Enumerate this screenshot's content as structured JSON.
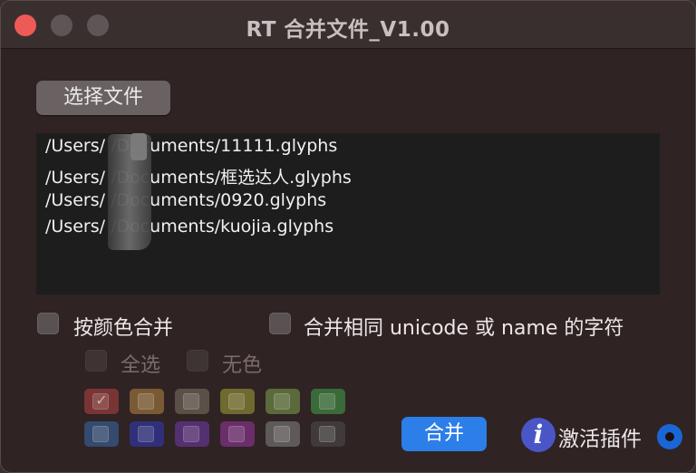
{
  "window": {
    "title": "RT 合并文件_V1.00"
  },
  "toolbar": {
    "choose_file_label": "选择文件"
  },
  "files": [
    "/Users/   /Documents/11111.glyphs",
    "/Users/   /Documents/框选达人.glyphs",
    "/Users/   /Documents/0920.glyphs",
    "/Users/   /Documents/kuojia.glyphs"
  ],
  "options": {
    "merge_by_color": {
      "label": "按颜色合并",
      "checked": false
    },
    "merge_same_unicode": {
      "label": "合并相同 unicode 或 name 的字符",
      "checked": false
    },
    "select_all": {
      "label": "全选",
      "checked": false,
      "enabled": false
    },
    "no_color": {
      "label": "无色",
      "checked": false,
      "enabled": false
    }
  },
  "color_swatches": [
    {
      "name": "red",
      "color": "#7a3434",
      "checked": true
    },
    {
      "name": "orange",
      "color": "#7a5a34",
      "checked": false
    },
    {
      "name": "brown",
      "color": "#5a5048",
      "checked": false
    },
    {
      "name": "yellow",
      "color": "#6e6a30",
      "checked": false
    },
    {
      "name": "light-green",
      "color": "#5a6a3a",
      "checked": false
    },
    {
      "name": "dark-green",
      "color": "#3a6a3a",
      "checked": false
    },
    {
      "name": "light-blue",
      "color": "#344a6e",
      "checked": false
    },
    {
      "name": "dark-blue",
      "color": "#30307a",
      "checked": false
    },
    {
      "name": "purple",
      "color": "#553070",
      "checked": false
    },
    {
      "name": "magenta",
      "color": "#6a2e6a",
      "checked": false
    },
    {
      "name": "light-gray",
      "color": "#5e5a5a",
      "checked": false
    },
    {
      "name": "dark-gray",
      "color": "#403a3a",
      "checked": false
    }
  ],
  "actions": {
    "merge_label": "合并",
    "activate_label": "激活插件",
    "accent": "#2c7ee8"
  }
}
